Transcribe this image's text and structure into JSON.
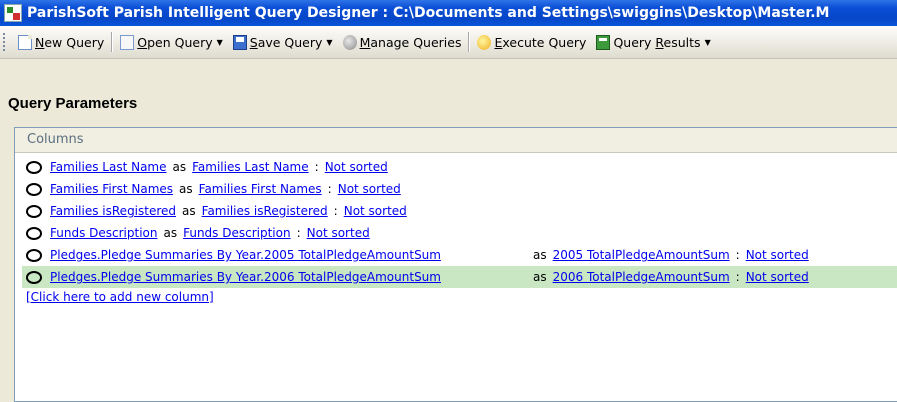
{
  "window": {
    "title": "ParishSoft Parish Intelligent Query Designer : C:\\Documents and Settings\\swiggins\\Desktop\\Master.M"
  },
  "toolbar": {
    "new_query": {
      "pre": "",
      "key": "N",
      "post": "ew Query"
    },
    "open_query": {
      "pre": "",
      "key": "O",
      "post": "pen Query"
    },
    "save_query": {
      "pre": "",
      "key": "S",
      "post": "ave Query"
    },
    "manage_queries": {
      "pre": "",
      "key": "M",
      "post": "anage Queries"
    },
    "execute_query": {
      "pre": "",
      "key": "E",
      "post": "xecute Query"
    },
    "query_results": {
      "pre": "Query ",
      "key": "R",
      "post": "esults"
    }
  },
  "section_title": "Query Parameters",
  "panel": {
    "header": "Columns",
    "as_text": "as",
    "colon_text": ":",
    "rows": [
      {
        "field": "Families Last Name",
        "alias": "Families Last Name",
        "sort": "Not sorted"
      },
      {
        "field": "Families First Names",
        "alias": "Families First Names",
        "sort": "Not sorted"
      },
      {
        "field": "Families isRegistered",
        "alias": "Families isRegistered",
        "sort": "Not sorted"
      },
      {
        "field": "Funds Description",
        "alias": "Funds Description",
        "sort": "Not sorted"
      },
      {
        "field": "Pledges.Pledge Summaries By Year.2005 TotalPledgeAmountSum",
        "alias": "2005 TotalPledgeAmountSum",
        "sort": "Not sorted"
      },
      {
        "field": "Pledges.Pledge Summaries By Year.2006 TotalPledgeAmountSum",
        "alias": "2006 TotalPledgeAmountSum",
        "sort": "Not sorted",
        "selected": true
      }
    ],
    "add_column": "[Click here to add new column]"
  }
}
